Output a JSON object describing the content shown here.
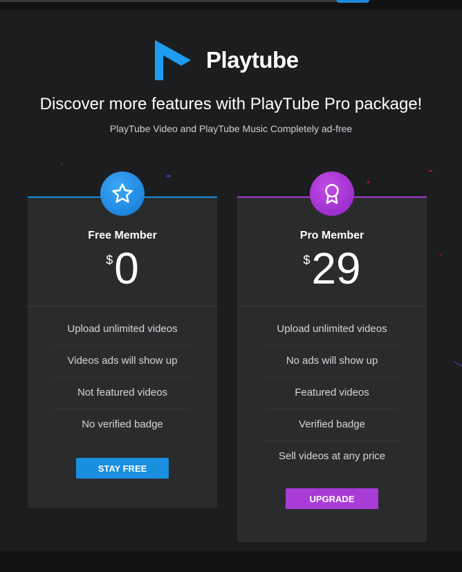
{
  "brand": {
    "name": "Playtube"
  },
  "header": {
    "headline": "Discover more features with PlayTube Pro package!",
    "subline": "PlayTube Video and PlayTube Music Completely ad-free"
  },
  "plans": [
    {
      "name": "Free Member",
      "currency": "$",
      "price": "0",
      "icon": "star-icon",
      "accent": "#1a8fe0",
      "features": [
        "Upload unlimited videos",
        "Videos ads will show up",
        "Not featured videos",
        "No verified badge"
      ],
      "button": "STAY FREE"
    },
    {
      "name": "Pro Member",
      "currency": "$",
      "price": "29",
      "icon": "award-ribbon-icon",
      "accent": "#a93cd6",
      "features": [
        "Upload unlimited videos",
        "No ads will show up",
        "Featured videos",
        "Verified badge",
        "Sell videos at any price"
      ],
      "button": "UPGRADE"
    }
  ],
  "colors": {
    "background": "#1c1d1f",
    "card": "#2a2b2d",
    "blue": "#1a8fe0",
    "purple": "#a93cd6"
  }
}
